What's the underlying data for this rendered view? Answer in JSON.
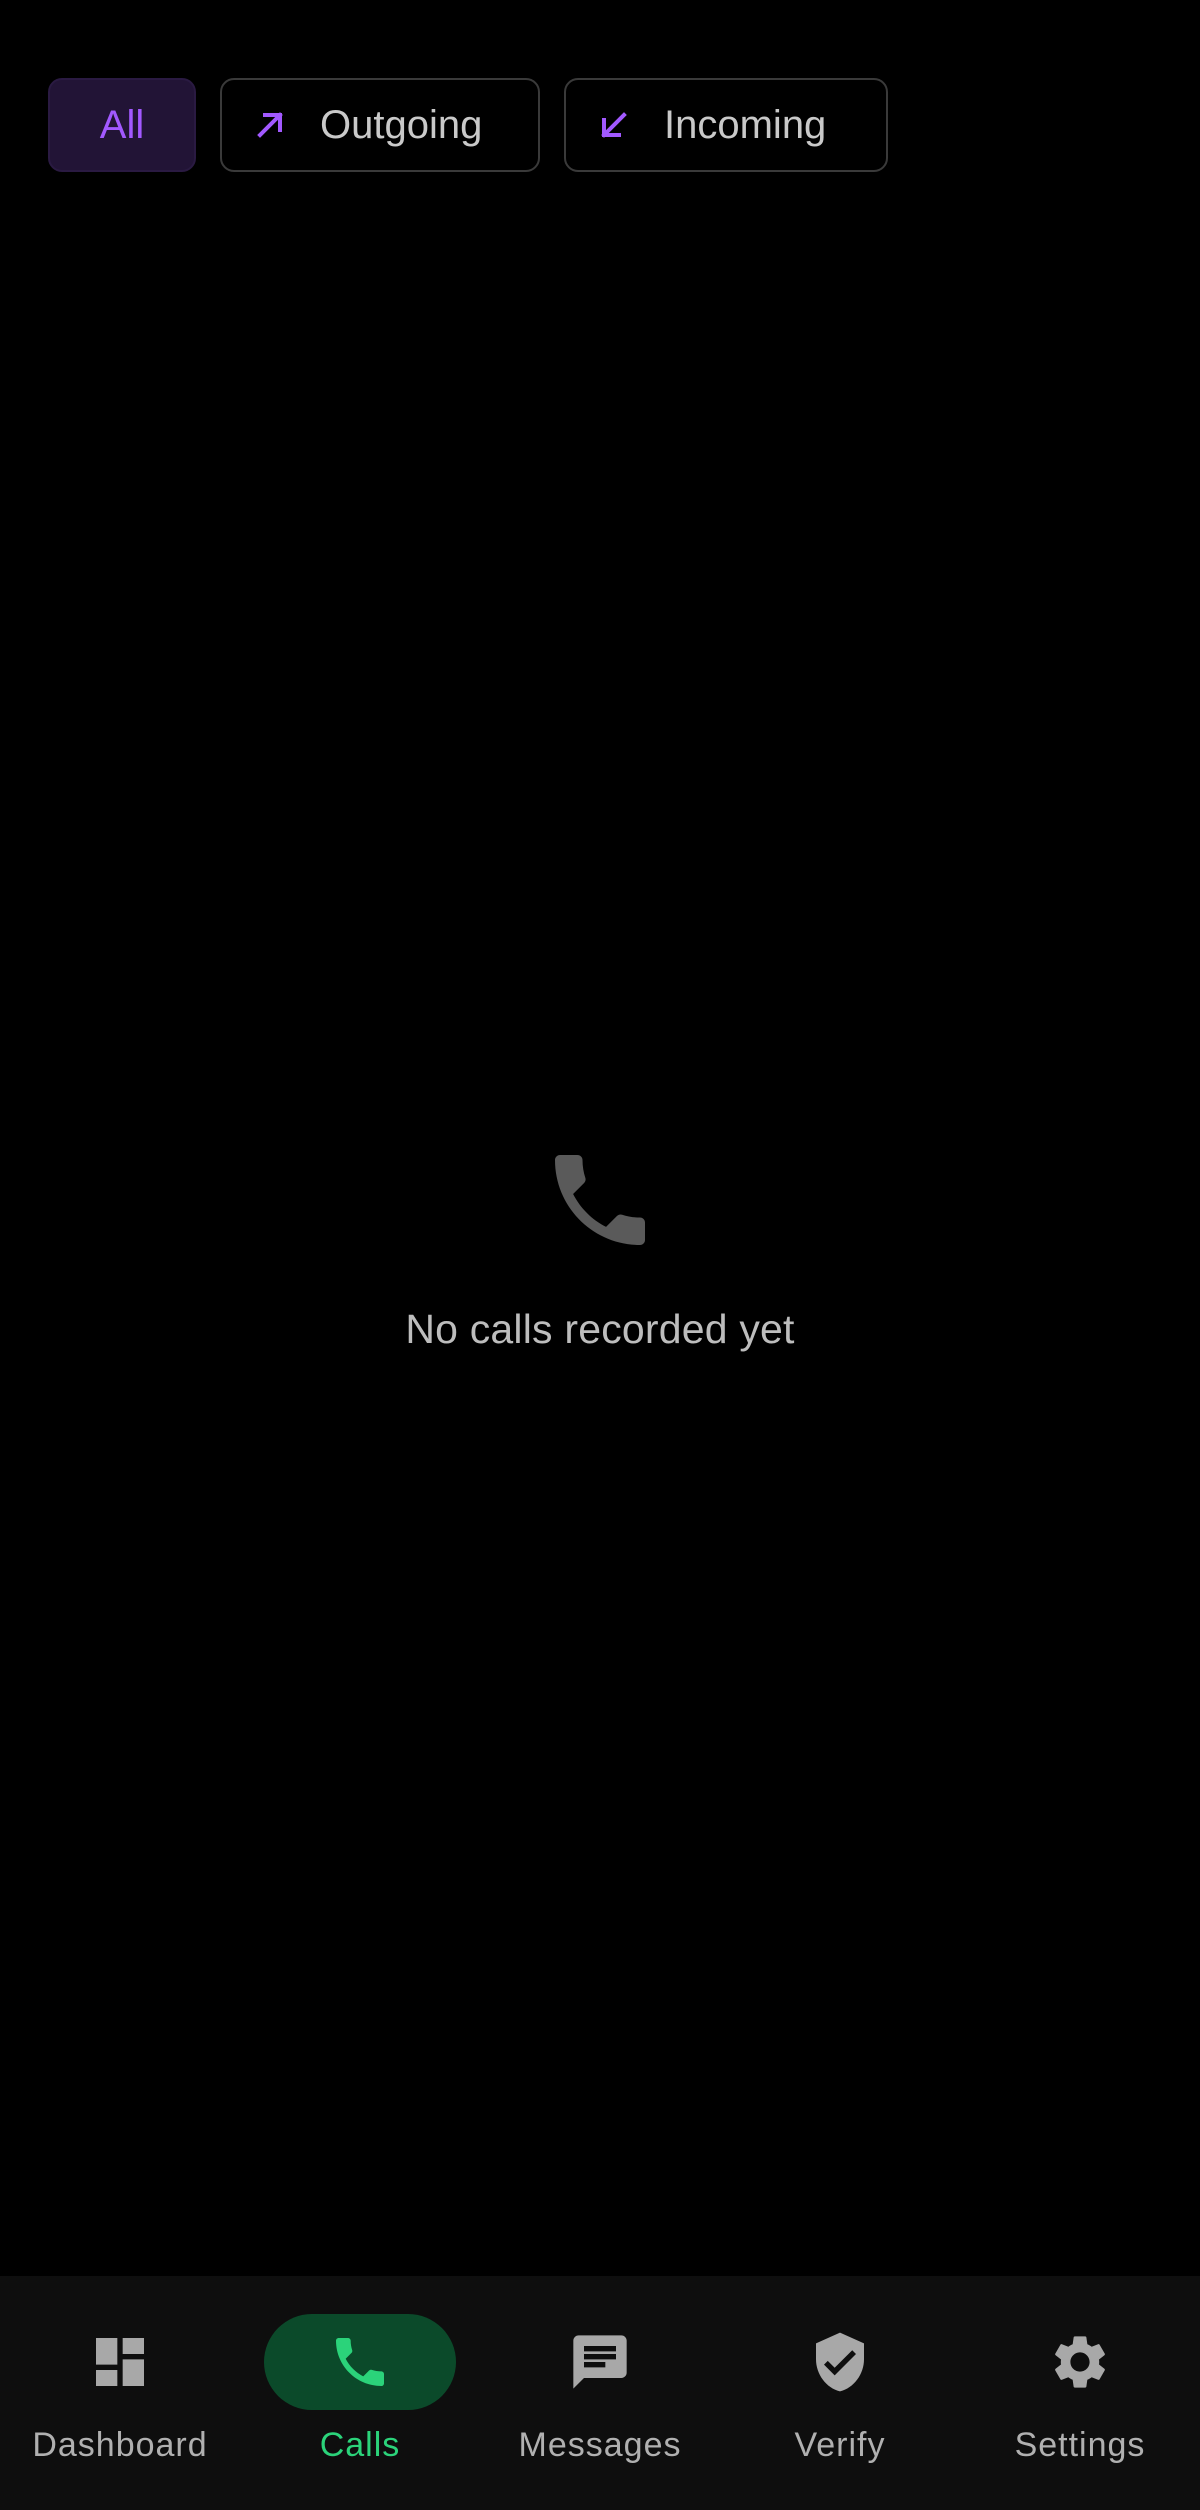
{
  "filters": {
    "all_label": "All",
    "outgoing_label": "Outgoing",
    "incoming_label": "Incoming",
    "selected": "All",
    "accent_color": "#a259ff"
  },
  "empty_state": {
    "icon": "phone-icon",
    "message": "No calls recorded yet"
  },
  "bottom_nav": {
    "active": "Calls",
    "active_color": "#2bd37a",
    "items": [
      {
        "label": "Dashboard",
        "icon": "dashboard-icon"
      },
      {
        "label": "Calls",
        "icon": "phone-icon"
      },
      {
        "label": "Messages",
        "icon": "message-icon"
      },
      {
        "label": "Verify",
        "icon": "shield-check-icon"
      },
      {
        "label": "Settings",
        "icon": "gear-icon"
      }
    ]
  }
}
